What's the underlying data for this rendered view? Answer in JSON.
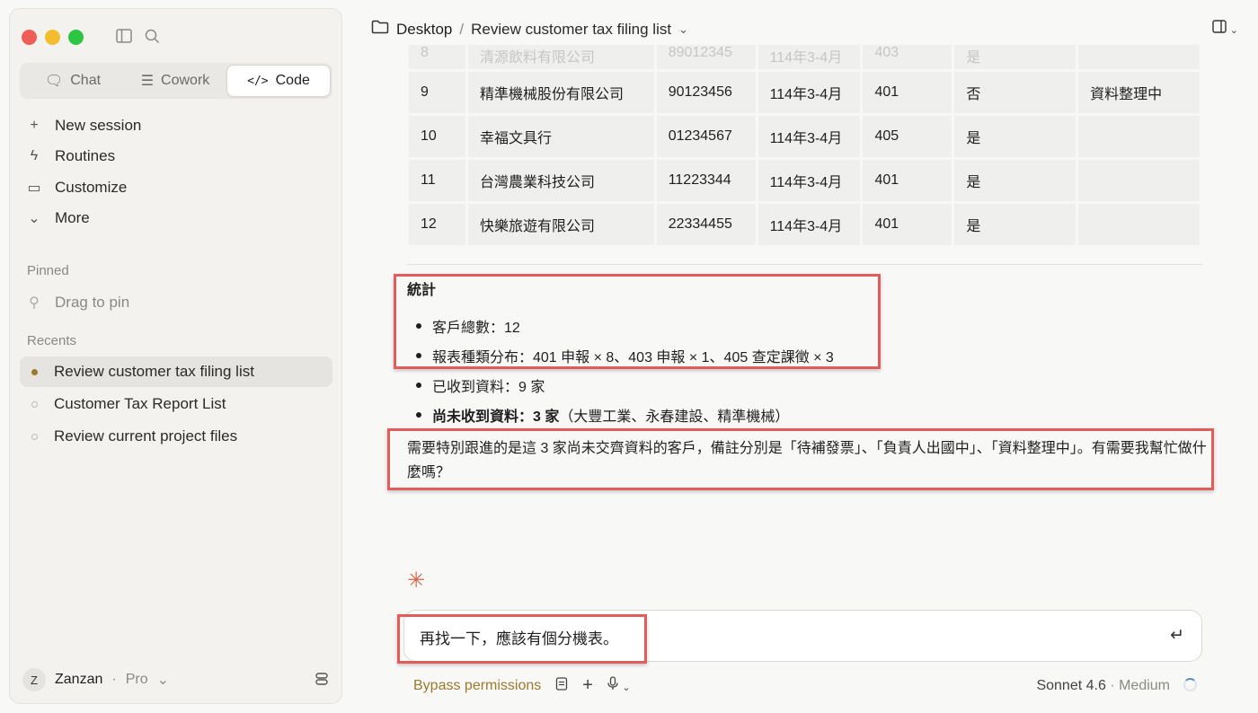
{
  "sidebar": {
    "mode_tabs": [
      {
        "label": "Chat",
        "icon": "chat-bubble-icon"
      },
      {
        "label": "Cowork",
        "icon": "checklist-icon"
      },
      {
        "label": "Code",
        "icon": "code-icon"
      }
    ],
    "nav": {
      "new_session": "New session",
      "routines": "Routines",
      "customize": "Customize",
      "more": "More"
    },
    "pinned_label": "Pinned",
    "drag_to_pin": "Drag to pin",
    "recents_label": "Recents",
    "recents": [
      "Review customer tax filing list",
      "Customer Tax Report List",
      "Review current project files"
    ],
    "user": {
      "initial": "Z",
      "name": "Zanzan",
      "plan": "Pro"
    }
  },
  "header": {
    "folder": "Desktop",
    "separator": "/",
    "title": "Review customer tax filing list"
  },
  "table": {
    "partial_row": [
      "8",
      "清源飲料有限公司",
      "89012345",
      "114年3-4月",
      "403",
      "是",
      ""
    ],
    "rows": [
      [
        "9",
        "精準機械股份有限公司",
        "90123456",
        "114年3-4月",
        "401",
        "否",
        "資料整理中"
      ],
      [
        "10",
        "幸福文具行",
        "01234567",
        "114年3-4月",
        "405",
        "是",
        ""
      ],
      [
        "11",
        "台灣農業科技公司",
        "11223344",
        "114年3-4月",
        "401",
        "是",
        ""
      ],
      [
        "12",
        "快樂旅遊有限公司",
        "22334455",
        "114年3-4月",
        "401",
        "是",
        ""
      ]
    ]
  },
  "stats": {
    "title": "統計",
    "items": [
      "客戶總數：12",
      "報表種類分布：401 申報 × 8、403 申報 × 1、405 查定課徵 × 3",
      "已收到資料：9 家"
    ],
    "bold_item_label": "尚未收到資料：3 家",
    "bold_item_rest": "（大豐工業、永春建設、精準機械）"
  },
  "paragraph": "需要特別跟進的是這 3 家尚未交齊資料的客戶，備註分別是「待補發票」、「負責人出國中」、「資料整理中」。有需要我幫忙做什麼嗎？",
  "composer": {
    "text": "再找一下，應該有個分機表。"
  },
  "toolbar": {
    "bypass": "Bypass permissions",
    "model": "Sonnet 4.6",
    "effort": "Medium"
  }
}
